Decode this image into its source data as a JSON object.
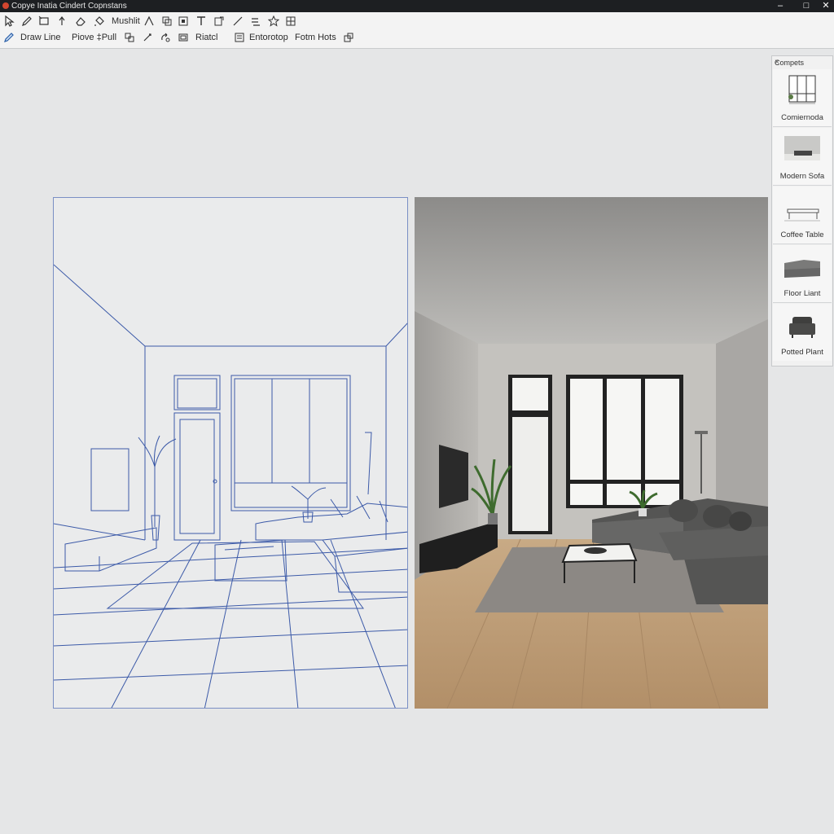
{
  "window": {
    "title": "Copye Inatia Cindert Copnstans",
    "controls": {
      "minimize": "–",
      "maximize": "□",
      "close": "✕"
    }
  },
  "toolbar": {
    "row1": {
      "icons": [
        "select-icon",
        "pencil-icon",
        "rectangle-icon",
        "push-pull-icon",
        "eraser-icon",
        "paint-bucket-icon"
      ],
      "label": "Mushlit",
      "icons2": [
        "measure-icon",
        "copy-icon",
        "component-icon",
        "text-icon",
        "section-icon",
        "line-tool-icon",
        "axes-icon",
        "star-icon",
        "grid-icon"
      ]
    },
    "row2": {
      "draw_line": "Draw Line",
      "push_pull": "Piove ‡Pull",
      "rotate": "Riatcl",
      "entourage": "Entorotop",
      "form_hots": "Fotm Hots"
    }
  },
  "components_panel": {
    "title": "Compets",
    "close_label": "×",
    "items": [
      {
        "label": "Comiernoda",
        "icon": "window-component-icon"
      },
      {
        "label": "Modern Sofa",
        "icon": "sofa-component-icon"
      },
      {
        "label": "Coffee Table",
        "icon": "coffee-table-component-icon"
      },
      {
        "label": "Floor Liant",
        "icon": "sectional-sofa-component-icon"
      },
      {
        "label": "Potted Plant",
        "icon": "armchair-component-icon"
      }
    ]
  },
  "colors": {
    "sketch_line": "#3c5aa8",
    "background": "#e5e6e7",
    "titlebar": "#1d1f22"
  }
}
